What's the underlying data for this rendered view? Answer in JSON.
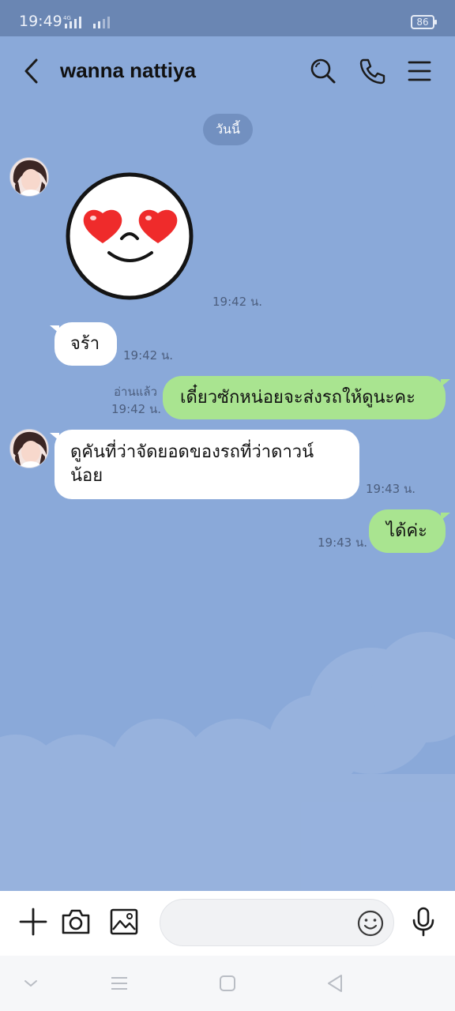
{
  "status_bar": {
    "time": "19:49",
    "battery": "86"
  },
  "header": {
    "title": "wanna nattiya"
  },
  "chat": {
    "date_divider": "วันนี้",
    "messages": [
      {
        "from": "contact",
        "type": "sticker",
        "time": "19:42 น."
      },
      {
        "from": "contact",
        "type": "text",
        "text": "จร้า",
        "time": "19:42 น."
      },
      {
        "from": "me",
        "type": "text",
        "text": "เดี๋ยวซักหน่อยจะส่งรถให้ดูนะคะ",
        "read": "อ่านแล้ว",
        "time": "19:42 น."
      },
      {
        "from": "contact",
        "type": "text",
        "text": "ดูคันที่ว่าจัดยอดของรถที่ว่าดาวน์น้อย",
        "time": "19:43 น."
      },
      {
        "from": "me",
        "type": "text",
        "text": "ได้ค่ะ",
        "time": "19:43 น."
      }
    ]
  },
  "input_bar": {
    "placeholder": ""
  },
  "colors": {
    "chat_background": "#8aa9d9",
    "outgoing_bubble": "#a9e490",
    "incoming_bubble": "#ffffff",
    "status_bar": "#6a86b3"
  },
  "icons": [
    "back-icon",
    "search-icon",
    "phone-icon",
    "menu-icon",
    "plus-icon",
    "camera-icon",
    "image-icon",
    "emoji-icon",
    "mic-icon"
  ]
}
